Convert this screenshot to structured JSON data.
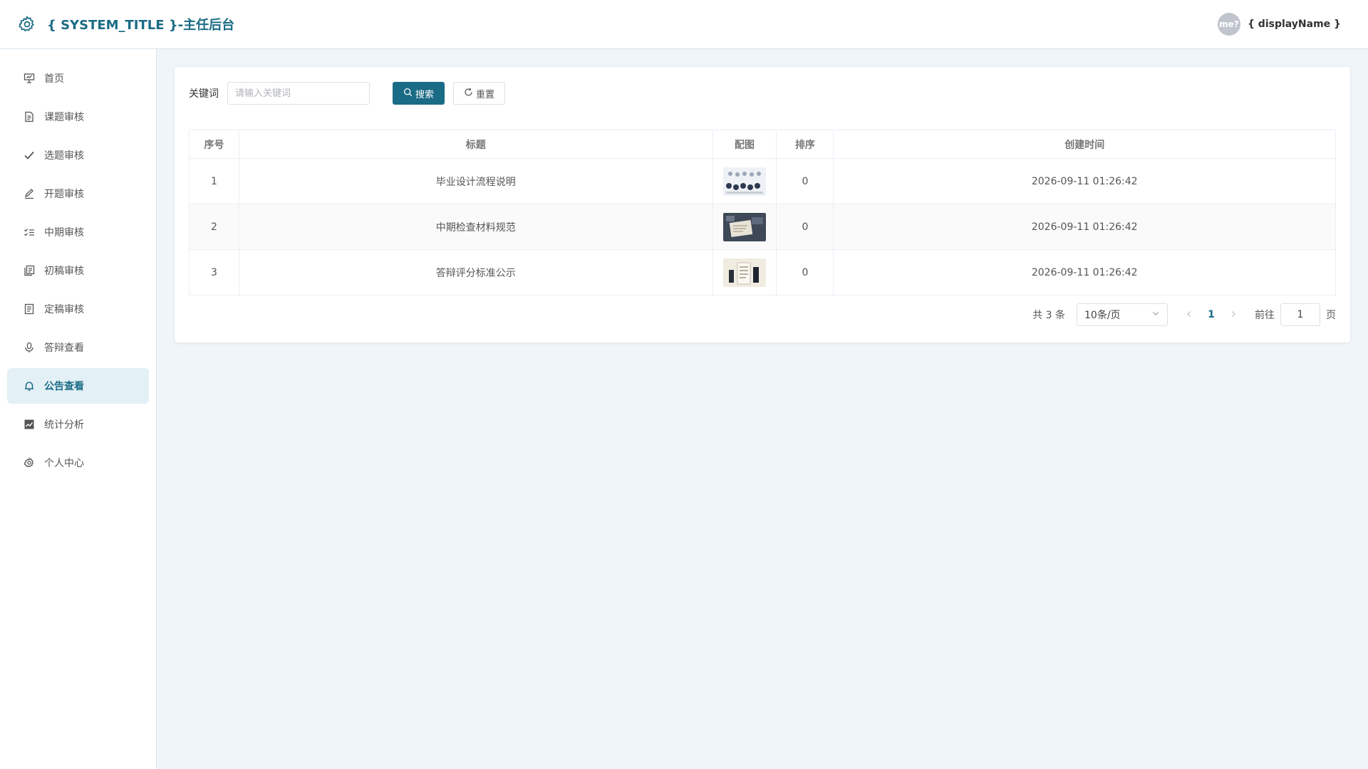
{
  "header": {
    "title": "{ SYSTEM_TITLE }-主任后台",
    "avatar_text": "me?",
    "username": "{ displayName }"
  },
  "sidebar": {
    "items": [
      {
        "label": "首页",
        "icon": "presentation-icon",
        "active": false
      },
      {
        "label": "课题审核",
        "icon": "document-icon",
        "active": false
      },
      {
        "label": "选题审核",
        "icon": "check-icon",
        "active": false
      },
      {
        "label": "开题审核",
        "icon": "pen-icon",
        "active": false
      },
      {
        "label": "中期审核",
        "icon": "checklist-icon",
        "active": false
      },
      {
        "label": "初稿审核",
        "icon": "copy-document-icon",
        "active": false
      },
      {
        "label": "定稿审核",
        "icon": "document-list-icon",
        "active": false
      },
      {
        "label": "答辩查看",
        "icon": "microphone-icon",
        "active": false
      },
      {
        "label": "公告查看",
        "icon": "bell-icon",
        "active": true
      },
      {
        "label": "统计分析",
        "icon": "chart-icon",
        "active": false
      },
      {
        "label": "个人中心",
        "icon": "gear-icon",
        "active": false
      }
    ]
  },
  "search": {
    "label": "关键词",
    "placeholder": "请输入关键词",
    "value": "",
    "search_label": "搜索",
    "reset_label": "重置"
  },
  "table": {
    "columns": [
      "序号",
      "标题",
      "配图",
      "排序",
      "创建时间"
    ],
    "rows": [
      {
        "index": "1",
        "title": "毕业设计流程说明",
        "image": "thumbnail-image-1",
        "sort": "0",
        "created": "2026-09-11 01:26:42"
      },
      {
        "index": "2",
        "title": "中期检查材料规范",
        "image": "thumbnail-image-2",
        "sort": "0",
        "created": "2026-09-11 01:26:42"
      },
      {
        "index": "3",
        "title": "答辩评分标准公示",
        "image": "thumbnail-image-3",
        "sort": "0",
        "created": "2026-09-11 01:26:42"
      }
    ]
  },
  "pagination": {
    "total_text": "共 3 条",
    "page_size": "10条/页",
    "current_page": "1",
    "goto_label": "前往",
    "goto_value": "1",
    "page_suffix": "页"
  },
  "colors": {
    "accent": "#1a6b85",
    "background": "#f0f5f9",
    "active_nav_bg": "#e3f0f6"
  }
}
